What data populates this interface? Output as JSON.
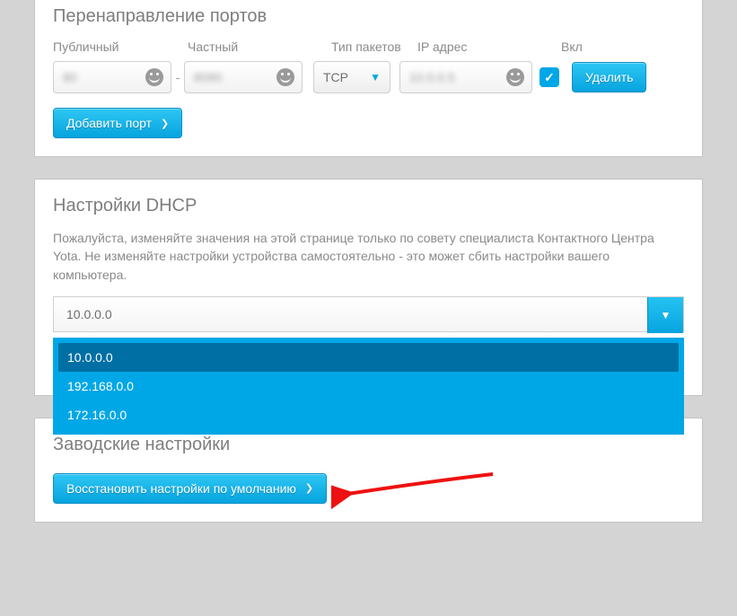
{
  "port_forwarding": {
    "title": "Перенаправление портов",
    "cols": {
      "public": "Публичный",
      "private": "Частный",
      "type": "Тип пакетов",
      "ip": "IP адрес",
      "enabled": "Вкл"
    },
    "row": {
      "public": "80",
      "private": "8080",
      "protocol": "TCP",
      "ip": "10.0.0.5",
      "enabled": true
    },
    "delete_label": "Удалить",
    "add_label": "Добавить порт"
  },
  "dhcp": {
    "title": "Настройки DHCP",
    "help": "Пожалуйста, изменяйте значения на этой странице только по совету специалиста Контактного Центра Yota. Не изменяйте настройки устройства самостоятельно - это может сбить настройки вашего компьютера.",
    "selected": "10.0.0.0",
    "options": [
      "10.0.0.0",
      "192.168.0.0",
      "172.16.0.0"
    ]
  },
  "factory": {
    "title": "Заводские настройки",
    "restore_label": "Восстановить настройки по умолчанию"
  }
}
